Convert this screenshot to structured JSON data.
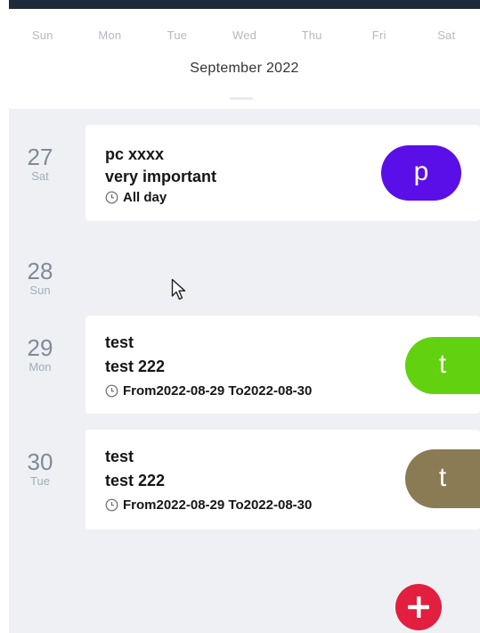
{
  "calendar": {
    "weekdays": [
      "Sun",
      "Mon",
      "Tue",
      "Wed",
      "Thu",
      "Fri",
      "Sat"
    ],
    "month_label": "September 2022"
  },
  "agenda": {
    "days": [
      {
        "day_num": "27",
        "day_name": "Sat",
        "event": {
          "title": "pc xxxx",
          "description": "very important",
          "time": "All day",
          "avatar_letter": "p",
          "avatar_color": "#5b0fe8"
        }
      },
      {
        "day_num": "28",
        "day_name": "Sun"
      },
      {
        "day_num": "29",
        "day_name": "Mon",
        "event": {
          "title": "test",
          "description": "test 222",
          "time": "From2022-08-29 To2022-08-30",
          "avatar_letter": "t",
          "avatar_color": "#62d10f"
        }
      },
      {
        "day_num": "30",
        "day_name": "Tue",
        "event": {
          "title": "test",
          "description": "test 222",
          "time": "From2022-08-29 To2022-08-30",
          "avatar_letter": "t",
          "avatar_color": "#8b7b55"
        }
      }
    ]
  },
  "colors": {
    "fab": "#e21f3e",
    "top_bar": "#1f2a3c",
    "background": "#eef0f3"
  },
  "icons": {
    "clock": "clock-icon",
    "add": "plus-icon",
    "cursor": "mouse-pointer-icon"
  }
}
